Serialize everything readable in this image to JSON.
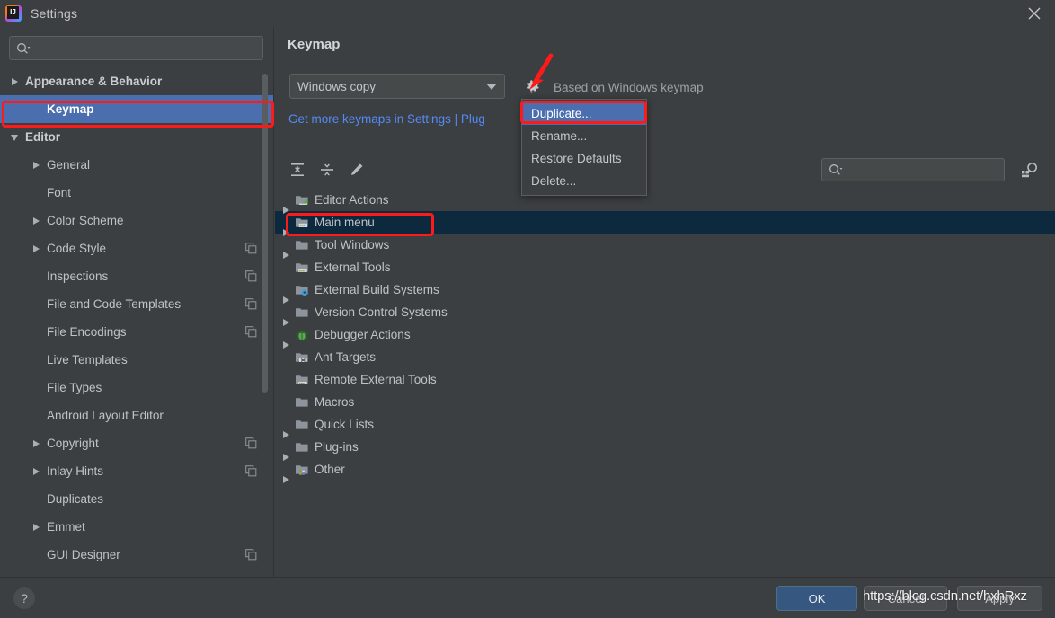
{
  "window": {
    "title": "Settings",
    "app_icon": "intellij-idea-icon",
    "close_icon": "close-icon"
  },
  "sidebar": {
    "search": {
      "placeholder": "",
      "value": "",
      "icon": "search-icon"
    },
    "items": [
      {
        "label": "Appearance & Behavior",
        "arrow": "right",
        "level": 0,
        "copy": false,
        "selected": false
      },
      {
        "label": "Keymap",
        "arrow": "none",
        "level": 1,
        "copy": false,
        "selected": true
      },
      {
        "label": "Editor",
        "arrow": "down",
        "level": 0,
        "copy": false,
        "selected": false
      },
      {
        "label": "General",
        "arrow": "right",
        "level": 1,
        "copy": false,
        "selected": false
      },
      {
        "label": "Font",
        "arrow": "none",
        "level": 1,
        "copy": false,
        "selected": false
      },
      {
        "label": "Color Scheme",
        "arrow": "right",
        "level": 1,
        "copy": false,
        "selected": false
      },
      {
        "label": "Code Style",
        "arrow": "right",
        "level": 1,
        "copy": true,
        "selected": false
      },
      {
        "label": "Inspections",
        "arrow": "none",
        "level": 1,
        "copy": true,
        "selected": false
      },
      {
        "label": "File and Code Templates",
        "arrow": "none",
        "level": 1,
        "copy": true,
        "selected": false
      },
      {
        "label": "File Encodings",
        "arrow": "none",
        "level": 1,
        "copy": true,
        "selected": false
      },
      {
        "label": "Live Templates",
        "arrow": "none",
        "level": 1,
        "copy": false,
        "selected": false
      },
      {
        "label": "File Types",
        "arrow": "none",
        "level": 1,
        "copy": false,
        "selected": false
      },
      {
        "label": "Android Layout Editor",
        "arrow": "none",
        "level": 1,
        "copy": false,
        "selected": false
      },
      {
        "label": "Copyright",
        "arrow": "right",
        "level": 1,
        "copy": true,
        "selected": false
      },
      {
        "label": "Inlay Hints",
        "arrow": "right",
        "level": 1,
        "copy": true,
        "selected": false
      },
      {
        "label": "Duplicates",
        "arrow": "none",
        "level": 1,
        "copy": false,
        "selected": false
      },
      {
        "label": "Emmet",
        "arrow": "right",
        "level": 1,
        "copy": false,
        "selected": false
      },
      {
        "label": "GUI Designer",
        "arrow": "none",
        "level": 1,
        "copy": true,
        "selected": false
      }
    ]
  },
  "main": {
    "title": "Keymap",
    "keymap_select": {
      "value": "Windows copy",
      "caret_icon": "chevron-down-icon"
    },
    "gear_icon": "gear-icon",
    "based_on": "Based on Windows keymap",
    "plugins_link": "Get more keymaps in Settings | Plug",
    "toolbar": {
      "expand_all_icon": "expand-all-icon",
      "collapse_all_icon": "collapse-all-icon",
      "edit_icon": "edit-pencil-icon",
      "search": {
        "value": "",
        "placeholder": "",
        "icon": "search-icon"
      },
      "find_by_shortcut_icon": "find-by-shortcut-icon"
    },
    "action_tree": [
      {
        "label": "Editor Actions",
        "arrow": "right",
        "icon": "folder-editor-icon",
        "selected": false
      },
      {
        "label": "Main menu",
        "arrow": "right",
        "icon": "folder-menu-icon",
        "selected": true
      },
      {
        "label": "Tool Windows",
        "arrow": "right",
        "icon": "folder-icon",
        "selected": false
      },
      {
        "label": "External Tools",
        "arrow": "none",
        "icon": "folder-tools-icon",
        "selected": false
      },
      {
        "label": "External Build Systems",
        "arrow": "right",
        "icon": "folder-build-icon",
        "selected": false
      },
      {
        "label": "Version Control Systems",
        "arrow": "right",
        "icon": "folder-icon",
        "selected": false
      },
      {
        "label": "Debugger Actions",
        "arrow": "right",
        "icon": "bug-icon",
        "selected": false
      },
      {
        "label": "Ant Targets",
        "arrow": "none",
        "icon": "folder-ant-icon",
        "selected": false
      },
      {
        "label": "Remote External Tools",
        "arrow": "none",
        "icon": "folder-remote-icon",
        "selected": false
      },
      {
        "label": "Macros",
        "arrow": "none",
        "icon": "folder-icon",
        "selected": false
      },
      {
        "label": "Quick Lists",
        "arrow": "right",
        "icon": "folder-icon",
        "selected": false
      },
      {
        "label": "Plug-ins",
        "arrow": "right",
        "icon": "folder-icon",
        "selected": false
      },
      {
        "label": "Other",
        "arrow": "right",
        "icon": "folder-other-icon",
        "selected": false
      }
    ]
  },
  "context_menu": {
    "items": [
      {
        "label": "Duplicate...",
        "selected": true
      },
      {
        "label": "Rename...",
        "selected": false
      },
      {
        "label": "Restore Defaults",
        "selected": false
      },
      {
        "label": "Delete...",
        "selected": false
      }
    ]
  },
  "bottom": {
    "help_label": "?",
    "ok_label": "OK",
    "cancel_label": "Cancel",
    "apply_label": "Apply"
  },
  "watermark": "https://blog.csdn.net/hxhRxz",
  "colors": {
    "background": "#3c3f41",
    "selection_blue": "#4b6eaf",
    "row_selected_navy": "#0d293e",
    "link_blue": "#548af7",
    "annotation_red": "#ff1a1a",
    "primary_button": "#365880"
  }
}
